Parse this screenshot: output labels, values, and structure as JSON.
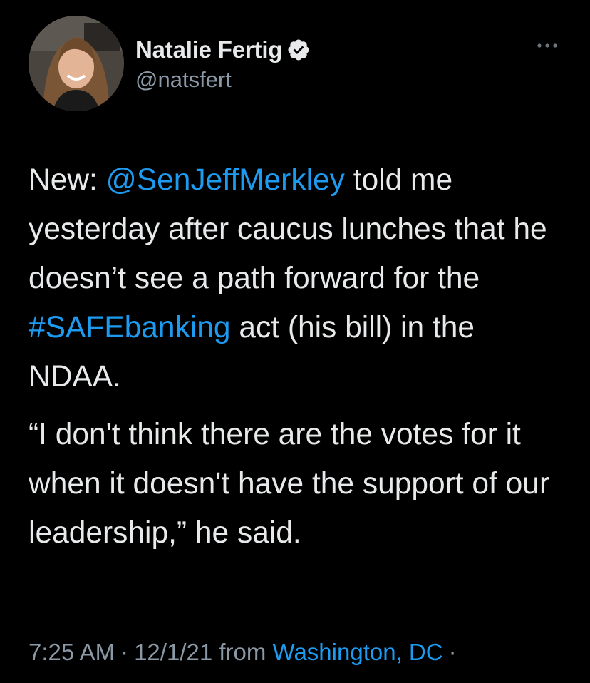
{
  "author": {
    "display_name": "Natalie Fertig",
    "handle": "@natsfert",
    "verified": true,
    "avatar_icon": "profile-photo"
  },
  "menu_icon": "more-icon",
  "tweet": {
    "para1": {
      "prefix": "New: ",
      "mention": "@SenJeffMerkley",
      "mid": " told me yesterday after caucus lunches that he doesn’t see a path forward for the ",
      "hashtag": "#SAFEbanking",
      "suffix": " act (his bill) in the NDAA."
    },
    "para2": "“I don't think there are the votes for it when it doesn't have the support of our leadership,” he said."
  },
  "meta": {
    "time": "7:25 AM",
    "separator": "·",
    "date": "12/1/21",
    "from_label": "from",
    "location": "Washington, DC",
    "trailing_separator": "·"
  },
  "colors": {
    "background": "#000000",
    "text": "#e7e9ea",
    "secondary": "#8b98a5",
    "link": "#1d9bf0"
  }
}
